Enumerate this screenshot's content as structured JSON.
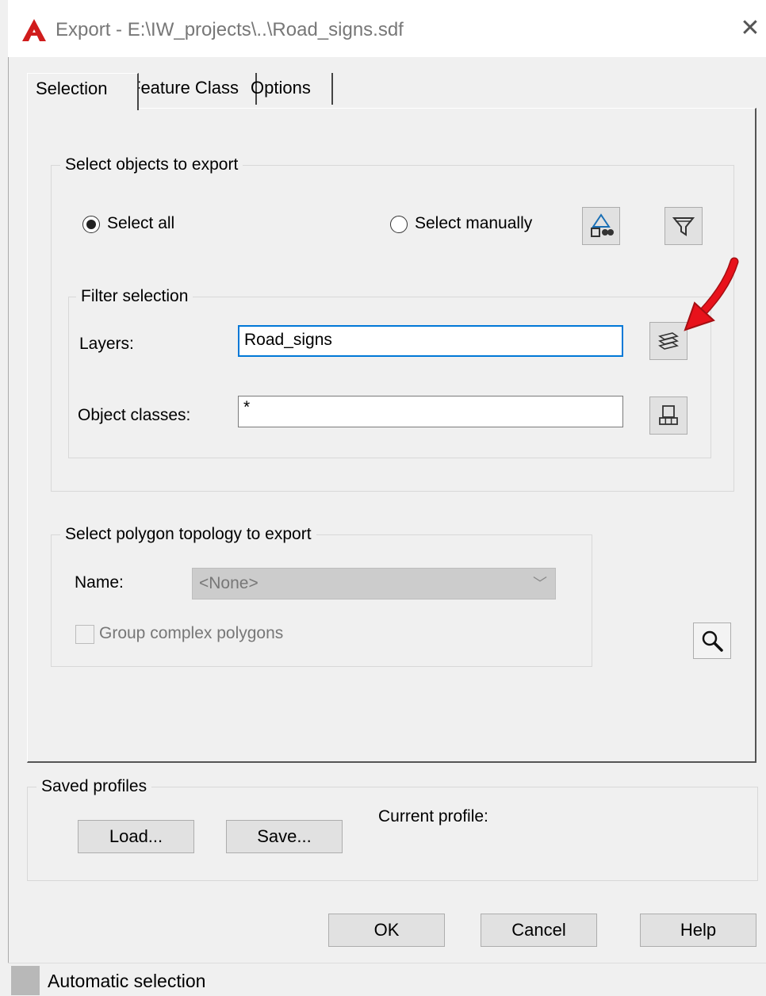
{
  "window": {
    "title": "Export - E:\\IW_projects\\..\\Road_signs.sdf",
    "close_glyph": "✕"
  },
  "tabs": [
    {
      "label": "Selection",
      "active": true
    },
    {
      "label": "Feature Class",
      "active": false
    },
    {
      "label": "Options",
      "active": false
    }
  ],
  "select_objects": {
    "legend": "Select objects to export",
    "radio_all": {
      "label": "Select all",
      "checked": true
    },
    "radio_manual": {
      "label": "Select manually",
      "checked": false
    },
    "buttons": [
      "select-objects-icon",
      "filter-funnel-icon"
    ]
  },
  "filter_selection": {
    "legend": "Filter selection",
    "layers_label": "Layers:",
    "layers_value": "Road_signs",
    "object_classes_label": "Object classes:",
    "object_classes_value": "*"
  },
  "polygon_topology": {
    "legend": "Select polygon topology to export",
    "name_label": "Name:",
    "name_value": "<None>",
    "group_complex_label": "Group complex polygons",
    "group_complex_checked": false
  },
  "saved_profiles": {
    "legend": "Saved profiles",
    "load_label": "Load...",
    "save_label": "Save...",
    "current_profile_label": "Current profile:"
  },
  "footer": {
    "ok_label": "OK",
    "cancel_label": "Cancel",
    "help_label": "Help"
  },
  "status": {
    "text": "Automatic selection"
  },
  "colors": {
    "accent": "#0078d7",
    "arrow": "#e8121b",
    "app_icon": "#d01c1c"
  }
}
